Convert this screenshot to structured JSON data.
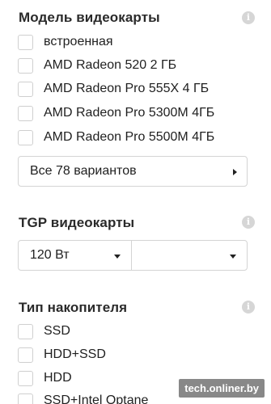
{
  "gpu_model": {
    "title": "Модель видеокарты",
    "info_glyph": "i",
    "options": [
      {
        "label": "встроенная"
      },
      {
        "label": "AMD Radeon 520 2 ГБ"
      },
      {
        "label": "AMD Radeon Pro 555X 4 ГБ"
      },
      {
        "label": "AMD Radeon Pro 5300M 4ГБ"
      },
      {
        "label": "AMD Radeon Pro 5500M 4ГБ"
      }
    ],
    "all_button": "Все 78 вариантов"
  },
  "gpu_tgp": {
    "title": "TGP видеокарты",
    "info_glyph": "i",
    "from_value": "120 Вт",
    "to_value": ""
  },
  "storage_type": {
    "title": "Тип накопителя",
    "info_glyph": "i",
    "options": [
      {
        "label": "SSD"
      },
      {
        "label": "HDD+SSD"
      },
      {
        "label": "HDD"
      },
      {
        "label": "SSD+Intel Optane"
      }
    ]
  },
  "watermark": "tech.onliner.by",
  "icons": {
    "info": "info-icon",
    "expand": "chevron-right-icon",
    "dropdown": "caret-down-icon"
  }
}
